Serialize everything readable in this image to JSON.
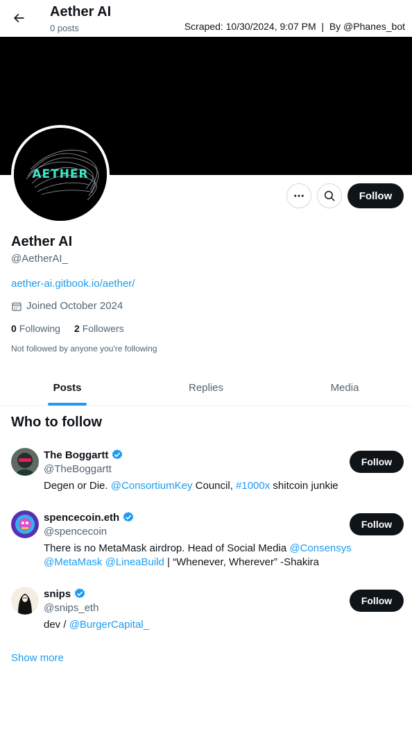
{
  "header": {
    "title": "Aether AI",
    "posts_count": "0 posts",
    "scrape_info": "Scraped: 10/30/2024, 9:07 PM  |  By @Phanes_bot"
  },
  "avatar": {
    "logo_text": "AETHER"
  },
  "actions": {
    "follow_label": "Follow"
  },
  "profile": {
    "name": "Aether AI",
    "handle": "@AetherAI_",
    "link": "aether-ai.gitbook.io/aether/",
    "joined": "Joined October 2024",
    "following_count": "0",
    "following_label": "Following",
    "followers_count": "2",
    "followers_label": "Followers",
    "not_followed": "Not followed by anyone you're following"
  },
  "tabs": [
    {
      "label": "Posts"
    },
    {
      "label": "Replies"
    },
    {
      "label": "Media"
    }
  ],
  "who_to_follow": {
    "title": "Who to follow",
    "show_more": "Show more",
    "follow_label": "Follow",
    "accounts": [
      {
        "name": "The Boggartt",
        "handle": "@TheBoggartt",
        "bio": [
          {
            "text": "Degen or Die. "
          },
          {
            "text": "@ConsortiumKey",
            "mention": true
          },
          {
            "text": " Council, "
          },
          {
            "text": "#1000x",
            "mention": true
          },
          {
            "text": " shitcoin junkie"
          }
        ]
      },
      {
        "name": "spencecoin.eth",
        "handle": "@spencecoin",
        "bio": [
          {
            "text": "There is no MetaMask airdrop. Head of Social Media "
          },
          {
            "text": "@Consensys",
            "mention": true
          },
          {
            "text": " "
          },
          {
            "text": "@MetaMask",
            "mention": true
          },
          {
            "text": " "
          },
          {
            "text": "@LineaBuild",
            "mention": true
          },
          {
            "text": " | “Whenever, Wherever” -Shakira"
          }
        ]
      },
      {
        "name": "snips",
        "handle": "@snips_eth",
        "bio": [
          {
            "text": "dev / "
          },
          {
            "text": "@BurgerCapital_",
            "mention": true
          }
        ]
      }
    ]
  },
  "colors": {
    "accent": "#1d9bf0",
    "text": "#0f1419",
    "muted": "#536471",
    "button_dark": "#0f1419",
    "logo_teal": "#3fe8c8"
  }
}
